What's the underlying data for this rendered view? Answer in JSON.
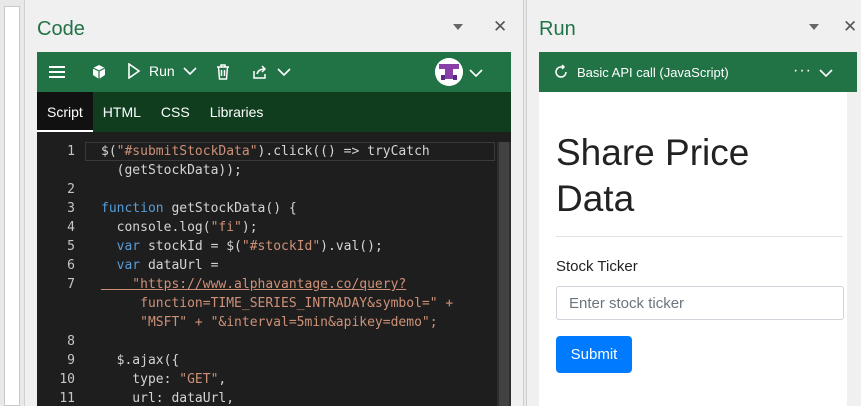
{
  "code_pane": {
    "title": "Code",
    "toolbar": {
      "run_label": "Run"
    },
    "tabs": [
      {
        "label": "Script",
        "active": true
      },
      {
        "label": "HTML",
        "active": false
      },
      {
        "label": "CSS",
        "active": false
      },
      {
        "label": "Libraries",
        "active": false
      }
    ],
    "line_numbers": [
      "1",
      "2",
      "3",
      "4",
      "5",
      "6",
      "7",
      "8",
      "9",
      "10",
      "11"
    ],
    "code_lines": [
      "$(\"#submitStockData\").click(() => tryCatch",
      "  (getStockData));",
      "",
      "function getStockData() {",
      "  console.log(\"fi\");",
      "  var stockId = $(\"#stockId\").val();",
      "  var dataUrl =",
      "    \"https://www.alphavantage.co/query?",
      "     function=TIME_SERIES_INTRADAY&symbol=\" +",
      "     \"MSFT\" + \"&interval=5min&apikey=demo\";",
      "",
      "  $.ajax({",
      "    type: \"GET\",",
      "    url: dataUrl,"
    ]
  },
  "run_pane": {
    "title": "Run",
    "toolbar": {
      "title": "Basic API call (JavaScript)",
      "more": "···"
    },
    "heading": "Share Price Data",
    "field_label": "Stock Ticker",
    "input_placeholder": "Enter stock ticker",
    "submit_label": "Submit"
  },
  "colors": {
    "accent_green": "#217346",
    "dark_green_tabs": "#0f3d1e",
    "editor_bg": "#1e1e1e",
    "keyword": "#569cd6",
    "string": "#ce9178",
    "submit_blue": "#007bff"
  },
  "icons": [
    "hamburger-icon",
    "cube-icon",
    "play-icon",
    "chevron-down-icon",
    "trash-icon",
    "share-icon",
    "avatar",
    "close-icon",
    "refresh-icon",
    "more-icon"
  ]
}
